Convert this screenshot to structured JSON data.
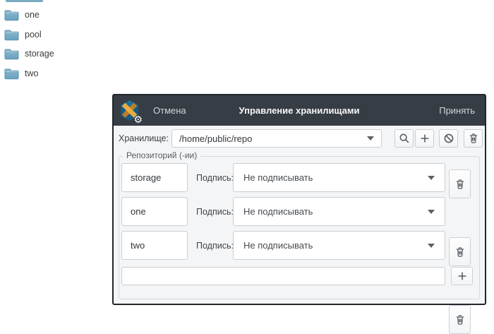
{
  "files": {
    "items": [
      {
        "label": "one"
      },
      {
        "label": "pool"
      },
      {
        "label": "storage"
      },
      {
        "label": "two"
      }
    ]
  },
  "dialog": {
    "cancel": "Отмена",
    "title": "Управление хранилищами",
    "accept": "Принять",
    "storage_label": "Хранилище:",
    "storage_value": "/home/public/repo",
    "group_legend": "Репозиторий (-ии)",
    "repos": [
      {
        "name": "storage",
        "sign_label": "Подпись:",
        "sign_value": "Не подписывать"
      },
      {
        "name": "one",
        "sign_label": "Подпись:",
        "sign_value": "Не подписывать"
      },
      {
        "name": "two",
        "sign_label": "Подпись:",
        "sign_value": "Не подписывать"
      }
    ],
    "new_repo_value": "",
    "colors": {
      "header_bg": "#373d45",
      "body_bg": "#f4f5f6",
      "folder_blue": "#74a9c4",
      "window_border": "#22262b"
    }
  }
}
